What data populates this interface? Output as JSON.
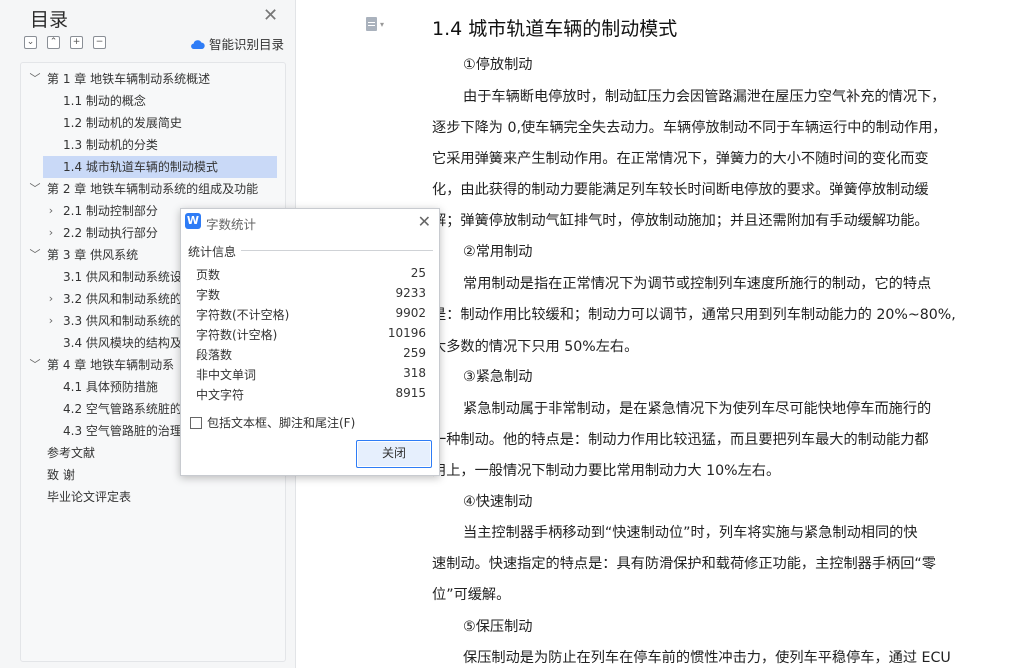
{
  "toc": {
    "title": "目录",
    "smart_label": "智能识别目录",
    "items": [
      {
        "label": "第 1 章  地铁车辆制动系统概述",
        "chevron": "﹀"
      },
      {
        "label": "1.1 制动的概念",
        "chevron": ""
      },
      {
        "label": "1.2 制动机的发展简史",
        "chevron": ""
      },
      {
        "label": "1.3 制动机的分类",
        "chevron": ""
      },
      {
        "label": "1.4 城市轨道车辆的制动模式",
        "chevron": ""
      },
      {
        "label": "第 2 章  地铁车辆制动系统的组成及功能",
        "chevron": "﹀"
      },
      {
        "label": "2.1 制动控制部分",
        "chevron": "›"
      },
      {
        "label": "2.2 制动执行部分",
        "chevron": "›"
      },
      {
        "label": "第 3 章  供风系统",
        "chevron": "﹀"
      },
      {
        "label": "3.1 供风和制动系统设",
        "chevron": ""
      },
      {
        "label": "3.2 供风和制动系统的",
        "chevron": "›"
      },
      {
        "label": "3.3 供风和制动系统的",
        "chevron": "›"
      },
      {
        "label": "3.4 供风模块的结构及",
        "chevron": ""
      },
      {
        "label": "第 4 章  地铁车辆制动系",
        "chevron": "﹀"
      },
      {
        "label": "4.1 具体预防措施",
        "chevron": ""
      },
      {
        "label": "4.2 空气管路系统脏的",
        "chevron": ""
      },
      {
        "label": "4.3 空气管路脏的治理",
        "chevron": ""
      },
      {
        "label": "参考文献",
        "chevron": ""
      },
      {
        "label": "致   谢",
        "chevron": ""
      },
      {
        "label": "毕业论文评定表",
        "chevron": ""
      }
    ]
  },
  "dialog": {
    "title": "字数统计",
    "section": "统计信息",
    "stats": [
      {
        "label": "页数",
        "value": "25"
      },
      {
        "label": "字数",
        "value": "9233"
      },
      {
        "label": "字符数(不计空格)",
        "value": "9902"
      },
      {
        "label": "字符数(计空格)",
        "value": "10196"
      },
      {
        "label": "段落数",
        "value": "259"
      },
      {
        "label": "非中文单词",
        "value": "318"
      },
      {
        "label": "中文字符",
        "value": "8915"
      }
    ],
    "checkbox_label": "包括文本框、脚注和尾注(F)",
    "close_label": "关闭"
  },
  "document": {
    "heading": "1.4 城市轨道车辆的制动模式",
    "paragraphs": [
      {
        "text": "①停放制动",
        "sub": true
      },
      {
        "text": "由于车辆断电停放时，制动缸压力会因管路漏泄在屋压力空气补充的情况下，",
        "sub": true
      },
      {
        "text": "逐步下降为 0,使车辆完全失去动力。车辆停放制动不同于车辆运行中的制动作用，",
        "sub": false
      },
      {
        "text": "它采用弹簧来产生制动作用。在正常情况下，弹簧力的大小不随时间的变化而变",
        "sub": false
      },
      {
        "text": "化，由此获得的制动力要能满足列车较长时间断电停放的要求。弹簧停放制动缓",
        "sub": false
      },
      {
        "text": "解；弹簧停放制动气缸排气时，停放制动施加；并且还需附加有手动缓解功能。",
        "sub": false
      },
      {
        "text": "②常用制动",
        "sub": true
      },
      {
        "text": "常用制动是指在正常情况下为调节或控制列车速度所施行的制动，它的特点",
        "sub": true
      },
      {
        "text": "是：制动作用比较缓和；制动力可以调节，通常只用到列车制动能力的 20%~80%,",
        "sub": false
      },
      {
        "text": "大多数的情况下只用 50%左右。",
        "sub": false
      },
      {
        "text": "③紧急制动",
        "sub": true
      },
      {
        "text": "紧急制动属于非常制动，是在紧急情况下为使列车尽可能快地停车而施行的",
        "sub": true
      },
      {
        "text": "一种制动。他的特点是：制动力作用比较迅猛，而且要把列车最大的制动能力都",
        "sub": false
      },
      {
        "text": "用上，一般情况下制动力要比常用制动力大 10%左右。",
        "sub": false
      },
      {
        "text": "④快速制动",
        "sub": true
      },
      {
        "text": "当主控制器手柄移动到“快速制动位”时，列车将实施与紧急制动相同的快",
        "sub": true
      },
      {
        "text": "速制动。快速指定的特点是：具有防滑保护和载荷修正功能，主控制器手柄回“零",
        "sub": false
      },
      {
        "text": "位”可缓解。",
        "sub": false
      },
      {
        "text": "⑤保压制动",
        "sub": true
      },
      {
        "text": "保压制动是为防止在列车在停车前的惯性冲击力，使列车平稳停车，通过 ECU",
        "sub": true
      }
    ]
  },
  "colors": {
    "selection": "#c9d9f7",
    "accent": "#2e7cf6"
  }
}
